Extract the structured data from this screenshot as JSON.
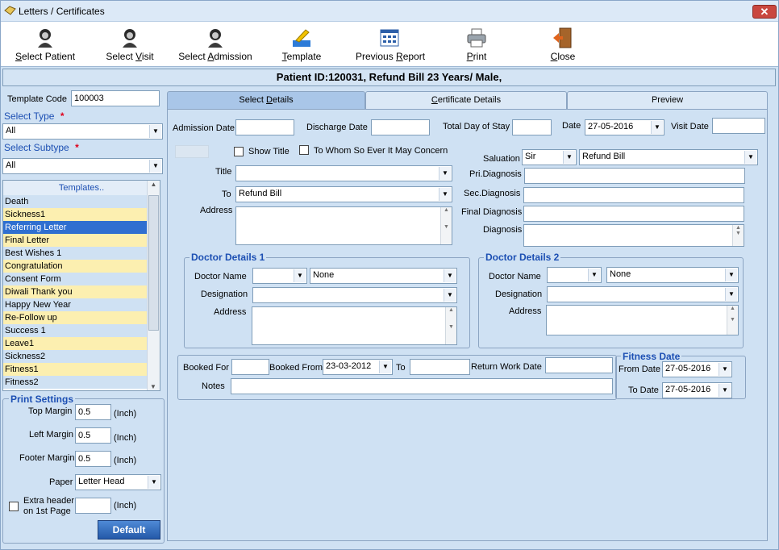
{
  "window": {
    "title": "Letters / Certificates",
    "close_glyph": "✕"
  },
  "toolbar": [
    {
      "name": "select-patient-button",
      "icon": "patient-icon",
      "pre": "",
      "u": "S",
      "post": "elect Patient"
    },
    {
      "name": "select-visit-button",
      "icon": "visit-icon",
      "pre": "Select ",
      "u": "V",
      "post": "isit"
    },
    {
      "name": "select-admission-button",
      "icon": "admission-icon",
      "pre": "Select ",
      "u": "A",
      "post": "dmission"
    },
    {
      "name": "template-button",
      "icon": "template-icon",
      "pre": "",
      "u": "T",
      "post": "emplate"
    },
    {
      "name": "previous-report-button",
      "icon": "report-icon",
      "pre": "Previous ",
      "u": "R",
      "post": "eport"
    },
    {
      "name": "print-button",
      "icon": "printer-icon",
      "pre": "",
      "u": "P",
      "post": "rint"
    },
    {
      "name": "close-button",
      "icon": "exit-door-icon",
      "pre": "",
      "u": "C",
      "post": "lose"
    }
  ],
  "patient_bar": "Patient ID:120031, Refund Bill  23 Years/ Male,",
  "left": {
    "template_code_label": "Template Code",
    "template_code_value": "100003",
    "select_type_label": "Select Type",
    "select_type_value": "All",
    "select_subtype_label": "Select Subtype",
    "select_subtype_value": "All",
    "required_mark": "*",
    "templates_header": "Templates..",
    "templates": [
      "Death",
      "Sickness1",
      "Referring Letter",
      "Final Letter",
      "Best Wishes 1",
      "Congratulation",
      "Consent Form",
      "Diwali Thank you",
      "Happy New Year",
      "Re-Follow  up",
      "Success 1",
      "Leave1",
      "Sickness2",
      "Fitness1",
      "Fitness2"
    ],
    "selected_template": "Referring Letter"
  },
  "print_settings": {
    "title": "Print Settings",
    "top_margin_label": "Top Margin",
    "top_margin_value": "0.5",
    "left_margin_label": "Left Margin",
    "left_margin_value": "0.5",
    "footer_margin_label": "Footer Margin",
    "footer_margin_value": "0.5",
    "unit": "(Inch)",
    "paper_label": "Paper",
    "paper_value": "Letter Head",
    "extra_header_label_1": "Extra header",
    "extra_header_label_2": "on 1st Page",
    "extra_header_value": "",
    "default_button": "Default"
  },
  "tabs": [
    {
      "pre": "Select ",
      "u": "D",
      "post": "etails",
      "active": true
    },
    {
      "pre": "",
      "u": "C",
      "post": "ertificate Details",
      "active": false
    },
    {
      "pre": "Preview",
      "u": "",
      "post": "",
      "active": false
    }
  ],
  "details": {
    "admission_date_label": "Admission Date",
    "admission_date_value": "",
    "discharge_date_label": "Discharge Date",
    "discharge_date_value": "",
    "total_stay_label": "Total Day of Stay",
    "total_stay_value": "",
    "date_label": "Date",
    "date_value": "27-05-2016",
    "visit_date_label": "Visit Date",
    "visit_date_value": "",
    "show_title_label": "Show Title",
    "to_whom_label": "To Whom So Ever It May Concern",
    "title_label": "Title",
    "title_value": "",
    "to_label": "To",
    "to_value": "Refund Bill",
    "address_label": "Address",
    "address_value": "",
    "salutation_label": "Saluation",
    "salutation_prefix": "Sir",
    "salutation_name": "Refund Bill",
    "pri_diag_label": "Pri.Diagnosis",
    "pri_diag_value": "",
    "sec_diag_label": "Sec.Diagnosis",
    "sec_diag_value": "",
    "final_diag_label": "Final Diagnosis",
    "final_diag_value": "",
    "diag_label": "Diagnosis",
    "diag_value": ""
  },
  "doctor1": {
    "title": "Doctor Details 1",
    "name_label": "Doctor Name",
    "prefix": "",
    "name_value": "None",
    "designation_label": "Designation",
    "designation_value": "",
    "address_label": "Address"
  },
  "doctor2": {
    "title": "Doctor Details 2",
    "name_label": "Doctor Name",
    "prefix": "",
    "name_value": "None",
    "designation_label": "Designation",
    "designation_value": "",
    "address_label": "Address"
  },
  "booking": {
    "booked_for_label": "Booked For",
    "booked_for_value": "",
    "booked_from_label": "Booked From",
    "booked_from_value": "23-03-2012",
    "to_label": "To",
    "to_value": "",
    "return_work_label": "Return Work Date",
    "return_work_value": "",
    "notes_label": "Notes",
    "notes_value": ""
  },
  "fitness": {
    "title": "Fitness Date",
    "from_label": "From Date",
    "from_value": "27-05-2016",
    "to_label": "To Date",
    "to_value": "27-05-2016"
  },
  "colors": {
    "selected_row": "#2f6fd0",
    "row_alt": "#fcefb0",
    "accent": "#1c4fb3",
    "required": "#e0001b"
  }
}
